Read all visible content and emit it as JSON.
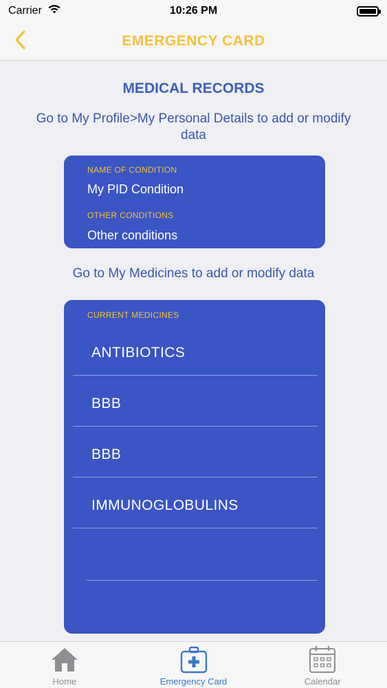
{
  "status_bar": {
    "carrier": "Carrier",
    "time": "10:26 PM"
  },
  "nav": {
    "title": "EMERGENCY CARD",
    "back_icon": "chevron-left-icon"
  },
  "medical_records": {
    "title": "MEDICAL RECORDS",
    "profile_hint": "Go to My Profile>My Personal Details to add or modify data",
    "condition_label": "NAME OF CONDITION",
    "condition_value": "My PID Condition",
    "other_label": "OTHER CONDITIONS",
    "other_value": "Other conditions",
    "medicines_hint": "Go to My Medicines to add or modify data",
    "medicines_label": "CURRENT MEDICINES",
    "medicines": [
      "ANTIBIOTICS",
      "BBB",
      "BBB",
      "IMMUNOGLOBULINS",
      ""
    ]
  },
  "tab_bar": {
    "tabs": [
      {
        "label": "Home",
        "icon": "home-icon"
      },
      {
        "label": "Emergency Card",
        "icon": "medical-kit-icon",
        "active": true
      },
      {
        "label": "Calendar",
        "icon": "calendar-icon"
      }
    ]
  },
  "colors": {
    "accent_yellow": "#f4c23f",
    "card_blue": "#3a55c4",
    "text_blue": "#3a57a8",
    "tab_active": "#3a78c9"
  }
}
